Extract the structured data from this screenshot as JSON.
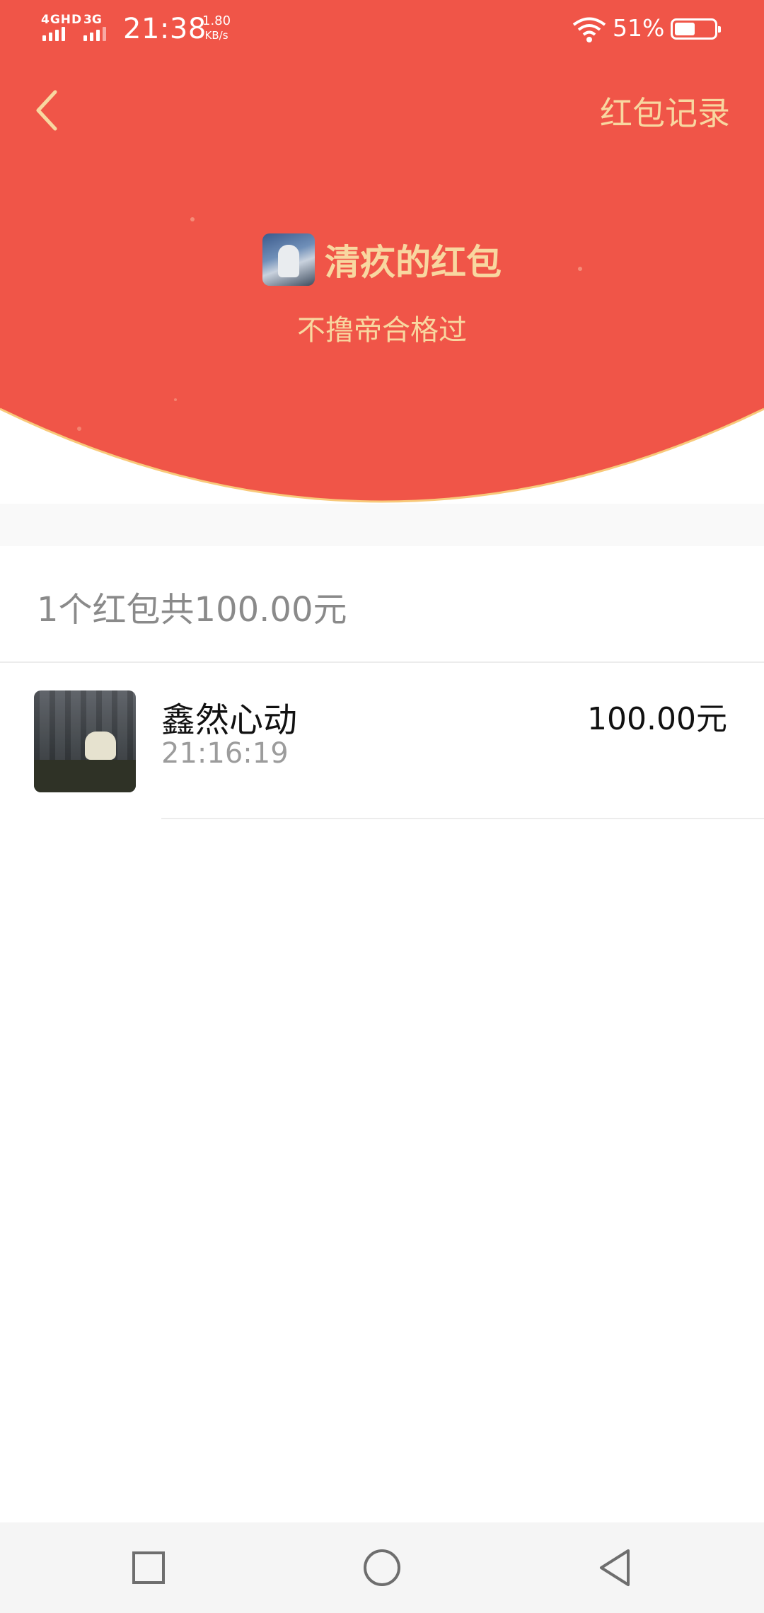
{
  "status_bar": {
    "network_1": "4GHD",
    "network_2": "3G",
    "time": "21:38",
    "speed_value": "1.80",
    "speed_unit": "KB/s",
    "battery_percent": "51%",
    "battery_level": 0.51
  },
  "header": {
    "records_link": "红包记录",
    "sender_name": "清疚的红包",
    "blessing": "不撸帝合格过"
  },
  "summary": "1个红包共100.00元",
  "records": [
    {
      "name": "鑫然心动",
      "time": "21:16:19",
      "amount": "100.00元"
    }
  ],
  "colors": {
    "header_red": "#f05548",
    "gold_text": "#f8d7a0",
    "arc_rim": "#f8c97a"
  },
  "icons": {
    "back": "chevron-left-icon",
    "nav_recent": "square-icon",
    "nav_home": "circle-icon",
    "nav_back": "triangle-back-icon"
  }
}
